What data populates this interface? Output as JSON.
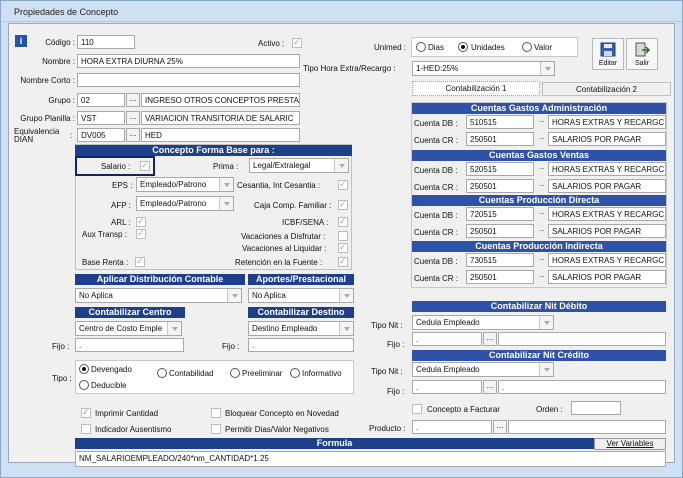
{
  "window": {
    "title": "Propiedades de Concepto"
  },
  "left": {
    "codigo_label": "Código :",
    "codigo_value": "110",
    "nombre_label": "Nombre :",
    "nombre_value": "HORA EXTRA DIURNA 25%",
    "nombre_corto_label": "Nombre Corto :",
    "nombre_corto_value": "",
    "grupo_label": "Grupo :",
    "grupo_code": "02",
    "grupo_name": "INGRESO OTROS CONCEPTOS PRESTA",
    "grupo_planilla_label": "Grupo Planilla :",
    "grupo_planilla_code": "VST",
    "grupo_planilla_name": "VARIACION TRANSITORIA DE SALARIC",
    "equivalencia_label_1": "Equivalencia",
    "equivalencia_label_2": "DIAN",
    "equivalencia_code": "DV005",
    "equivalencia_name": "HED",
    "dots": "..."
  },
  "top": {
    "activo_label": "Activo :",
    "unimed_label": "Unimed :",
    "unimed_options": [
      "Dias",
      "Unidades",
      "Valor"
    ],
    "unimed_selected": "Unidades",
    "tipo_hora_label": "Tipo Hora Extra/Recargo :",
    "tipo_hora_value": "1-HED:25%",
    "editar_label": "Editar",
    "salir_label": "Salir"
  },
  "forma_base": {
    "title": "Concepto Forma Base para :",
    "salario_label": "Salario :",
    "prima_label": "Prima :",
    "prima_value": "Legal/Extralegal",
    "eps_label": "EPS :",
    "eps_value": "Empleado/Patrono",
    "afp_label": "AFP :",
    "afp_value": "Empleado/Patrono",
    "arl_label": "ARL :",
    "aux_transp_label": "Aux Transp :",
    "base_renta_label": "Base Renta :",
    "cesantia_label": "Cesantia, Int Cesantia :",
    "caja_label": "Caja Comp. Familiar :",
    "icbf_label": "ICBF/SENA :",
    "vac_disfrutar_label": "Vacaciones a Disfrutar :",
    "vac_liquidar_label": "Vacaciones al Liquidar :",
    "retencion_label": "Retención en la Fuente :"
  },
  "distribucion": {
    "title": "Aplicar Distribución Contable",
    "value": "No Aplica"
  },
  "aportes": {
    "title": "Aportes/Prestacional",
    "value": "No Aplica"
  },
  "cont_centro": {
    "title": "Contabilizar Centro",
    "value": "Centro de Costo Emple",
    "fijo_label": "Fijo :",
    "fijo_value": "."
  },
  "cont_destino": {
    "title": "Contabilizar Destino",
    "value": "Destino Empleado",
    "fijo_label": "Fijo :",
    "fijo_value": "."
  },
  "tipo": {
    "label": "Tipo :",
    "options": [
      "Devengado",
      "Contabilidad",
      "Preeliminar",
      "Informativo",
      "Deducible"
    ],
    "selected": "Devengado"
  },
  "checks": {
    "imprimir_cantidad": "Imprimir Cantidad",
    "indicador_ausentismo": "Indicador Ausentismo",
    "bloquear_concepto": "Bloquear Concepto en Novedad",
    "permitir_dias": "Permitir Dias/Valor Negativos"
  },
  "formula": {
    "title": "Formula",
    "ver_variables": "Ver Variables",
    "value": "NM_SALARIOEMPLEADO/240*nm_CANTIDAD*1.25"
  },
  "tabs": [
    "Contabilización 1",
    "Contabilización 2"
  ],
  "cuentas": [
    {
      "title": "Cuentas Gastos Administración",
      "db_code": "510515",
      "db_name": "HORAS EXTRAS Y RECARGC",
      "cr_code": "250501",
      "cr_name": "SALARIOS POR PAGAR"
    },
    {
      "title": "Cuentas Gastos Ventas",
      "db_code": "520515",
      "db_name": "HORAS EXTRAS Y RECARGC",
      "cr_code": "250501",
      "cr_name": "SALARIOS POR PAGAR"
    },
    {
      "title": "Cuentas Producción Directa",
      "db_code": "720515",
      "db_name": "HORAS EXTRAS Y RECARGC",
      "cr_code": "250501",
      "cr_name": "SALARIOS POR PAGAR"
    },
    {
      "title": "Cuentas Producción Indirecta",
      "db_code": "730515",
      "db_name": "HORAS EXTRAS Y RECARGC",
      "cr_code": "250501",
      "cr_name": "SALARIOS POR PAGAR"
    }
  ],
  "cuenta_db_label": "Cuenta DB :",
  "cuenta_cr_label": "Cuenta CR :",
  "nit_debito": {
    "title": "Contabilizar Nit Débito",
    "tipo_label": "Tipo Nit :",
    "tipo_value": "Cedula Empleado",
    "fijo_label": "Fijo :",
    "fijo_value": "."
  },
  "nit_credito": {
    "title": "Contabilizar Nit Crédito",
    "tipo_label": "Tipo Nit :",
    "tipo_value": "Cedula Empleado",
    "fijo_label": "Fijo :",
    "fijo_value": ".",
    "fijo_value2": "."
  },
  "concepto_facturar": "Concepto a Facturar",
  "orden_label": "Orden :",
  "producto_label": "Producto :",
  "producto_value": "."
}
